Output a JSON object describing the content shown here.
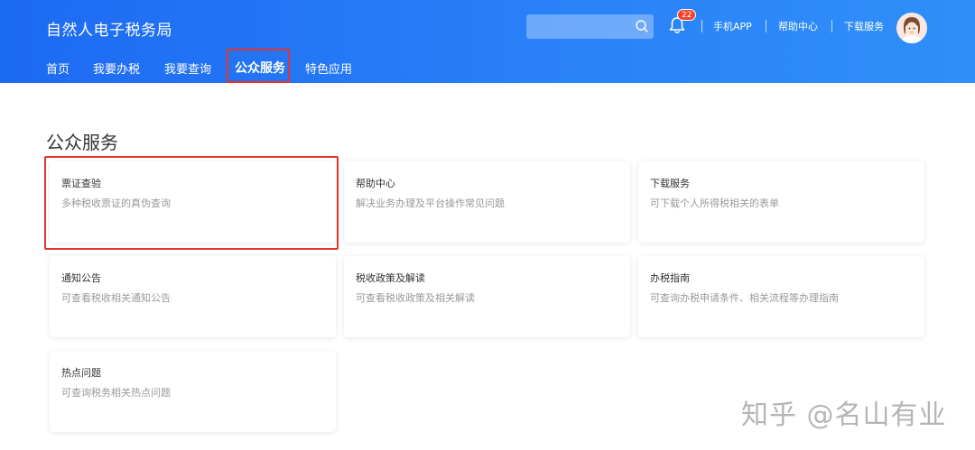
{
  "header": {
    "site_title": "自然人电子税务局",
    "search": {
      "placeholder": ""
    },
    "notification_count": "22",
    "links": [
      "手机APP",
      "帮助中心",
      "下载服务"
    ]
  },
  "nav": {
    "items": [
      "首页",
      "我要办税",
      "我要查询",
      "公众服务",
      "特色应用"
    ],
    "active": "公众服务"
  },
  "main": {
    "title": "公众服务",
    "cards": [
      {
        "title": "票证查验",
        "desc": "多种税收票证的真伪查询"
      },
      {
        "title": "帮助中心",
        "desc": "解决业务办理及平台操作常见问题"
      },
      {
        "title": "下载服务",
        "desc": "可下载个人所得税相关的表单"
      },
      {
        "title": "通知公告",
        "desc": "可查看税收相关通知公告"
      },
      {
        "title": "税收政策及解读",
        "desc": "可查看税收政策及相关解读"
      },
      {
        "title": "办税指南",
        "desc": "可查询办税申请条件、相关流程等办理指南"
      },
      {
        "title": "热点问题",
        "desc": "可查询税务相关热点问题"
      }
    ]
  },
  "watermark": "知乎 @名山有业",
  "colors": {
    "header_blue": "#1d6af2",
    "highlight_red": "#e5322d",
    "badge_red": "#f5422d"
  }
}
